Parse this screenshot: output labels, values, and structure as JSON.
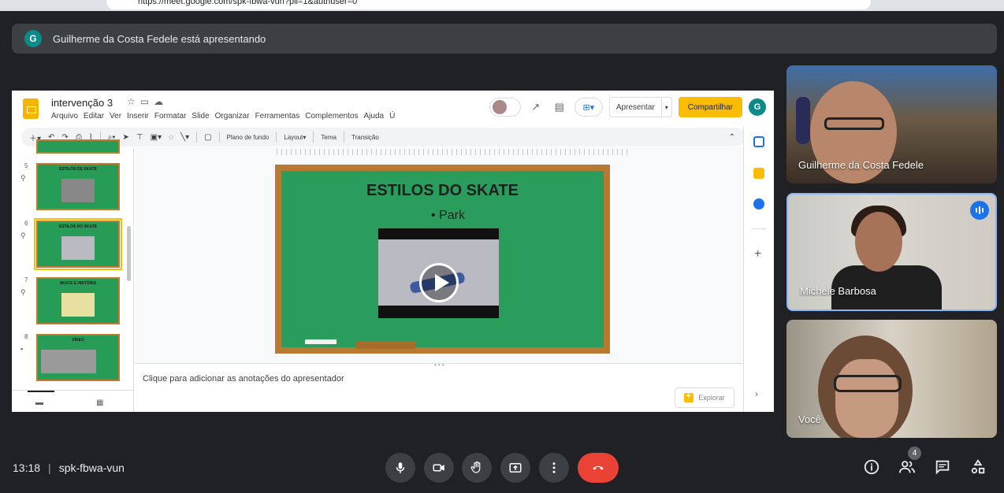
{
  "browser": {
    "url": "https://meet.google.com/spk-fbwa-vun?pli=1&authuser=0"
  },
  "banner": {
    "avatar_letter": "G",
    "text": "Guilherme da Costa Fedele está apresentando"
  },
  "slides_app": {
    "doc_title": "intervenção 3",
    "menu": [
      "Arquivo",
      "Editar",
      "Ver",
      "Inserir",
      "Formatar",
      "Slide",
      "Organizar",
      "Ferramentas",
      "Complementos",
      "Ajuda",
      "Ú"
    ],
    "present_label": "Apresentar",
    "share_label": "Compartilhar",
    "user_letter": "G",
    "toolbar": {
      "background": "Plano de fundo",
      "layout": "Layout",
      "theme": "Tema",
      "transition": "Transição"
    },
    "thumbnails": [
      {
        "num": "5",
        "title": "ESTILOS DE SKATE"
      },
      {
        "num": "6",
        "title": "ESTILOS DO SKATE"
      },
      {
        "num": "7",
        "title": "SKATE E HISTÓRIA"
      },
      {
        "num": "8",
        "title": "VÍDEO"
      }
    ],
    "slide": {
      "title": "ESTILOS DO SKATE",
      "bullet": "•  Park"
    },
    "notes_placeholder": "Clique para adicionar as anotações do apresentador",
    "explore_label": "Explorar"
  },
  "participants": [
    {
      "name": "Guilherme da Costa Fedele"
    },
    {
      "name": "Michele Barbosa"
    },
    {
      "name": "Você"
    }
  ],
  "bottom": {
    "time": "13:18",
    "divider": "|",
    "meeting_code": "spk-fbwa-vun",
    "participant_count": "4"
  },
  "colors": {
    "end_call": "#ea4335",
    "share_button": "#fbbc04",
    "speaking": "#1a73e8",
    "board_green": "#2a9d5c"
  }
}
